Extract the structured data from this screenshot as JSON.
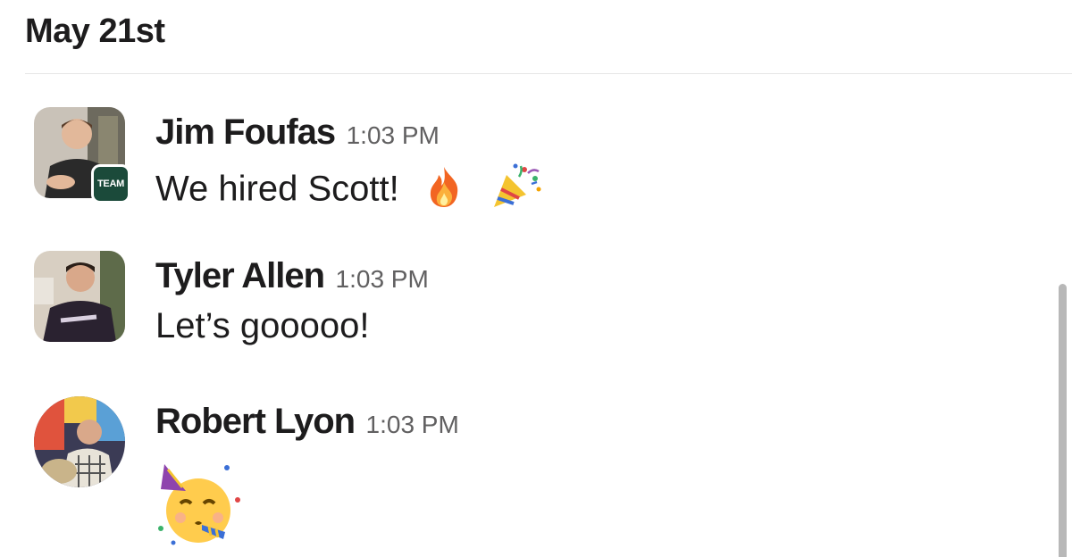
{
  "date_header": "May 21st",
  "messages": [
    {
      "sender": "Jim Foufas",
      "time": "1:03 PM",
      "text": "We hired Scott!",
      "badge": "TEAM",
      "emojis": [
        "fire-icon",
        "party-popper-icon"
      ]
    },
    {
      "sender": "Tyler Allen",
      "time": "1:03 PM",
      "text": "Let’s gooooo!"
    },
    {
      "sender": "Robert Lyon",
      "time": "1:03 PM",
      "text": "",
      "emojis": [
        "partying-face-icon"
      ]
    }
  ],
  "colors": {
    "text": "#1d1c1d",
    "timestamp": "#616061",
    "badge": "#1b4a3a"
  }
}
